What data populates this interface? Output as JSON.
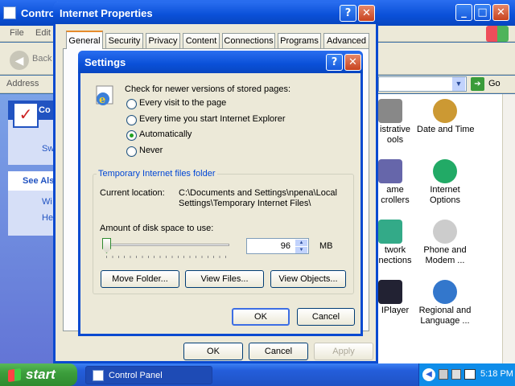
{
  "colors": {
    "taskbar": "#245edb",
    "start": "#3c9e3c",
    "titlebar": "#0a50d8",
    "dialog": "#ece9d8"
  },
  "control_panel": {
    "title": "Contro",
    "menu_file": "File",
    "menu_edit": "Edit",
    "back_label": "Back",
    "address_label": "Address",
    "go_label": "Go",
    "task_title": "Co",
    "task_item": "Sw",
    "see_also": "See Als",
    "see_also_1": "Wi",
    "see_also_2": "He",
    "icons": [
      {
        "label": "istrative\nools"
      },
      {
        "label": "Date and Time"
      },
      {
        "label": "ame\ncrollers"
      },
      {
        "label": "Internet\nOptions"
      },
      {
        "label": "twork\nnections"
      },
      {
        "label": "Phone and\nModem ..."
      },
      {
        "label": "IPlayer"
      },
      {
        "label": "Regional and\nLanguage ..."
      }
    ]
  },
  "inet": {
    "title": "Internet Properties",
    "tabs": [
      "General",
      "Security",
      "Privacy",
      "Content",
      "Connections",
      "Programs",
      "Advanced"
    ],
    "ok": "OK",
    "cancel": "Cancel",
    "apply": "Apply"
  },
  "settings": {
    "title": "Settings",
    "help": "?",
    "close": "✕",
    "check_label": "Check for newer versions of stored pages:",
    "options": [
      "Every visit to the page",
      "Every time you start Internet Explorer",
      "Automatically",
      "Never"
    ],
    "selected_option": "Automatically",
    "group_title": "Temporary Internet files folder",
    "current_location_label": "Current location:",
    "current_location_line1": "C:\\Documents and Settings\\npena\\Local",
    "current_location_line2": "Settings\\Temporary Internet Files\\",
    "disk_label": "Amount of disk space to use:",
    "disk_value": "96",
    "disk_unit": "MB",
    "slider_fraction": 0.0,
    "move_folder": "Move Folder...",
    "view_files": "View Files...",
    "view_objects": "View Objects...",
    "ok": "OK",
    "cancel": "Cancel"
  },
  "taskbar": {
    "start": "start",
    "task": "Control Panel",
    "clock": "5:18 PM"
  }
}
